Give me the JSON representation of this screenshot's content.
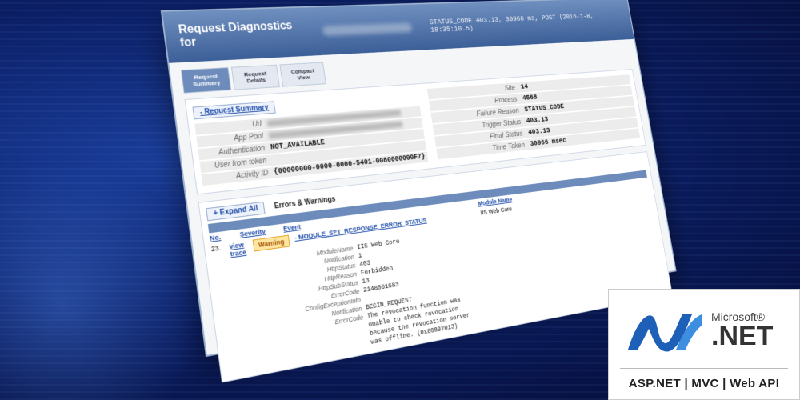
{
  "window": {
    "title": "Request Diagnostics for",
    "status": "STATUS_CODE 403.13, 30966 ms, POST (2016-1-8, 18:35:10.5)"
  },
  "tabs": [
    {
      "label": "Request Summary"
    },
    {
      "label": "Request Details"
    },
    {
      "label": "Compact View"
    }
  ],
  "summary": {
    "section_label": "- Request Summary",
    "left": [
      {
        "key": "Url",
        "value": ""
      },
      {
        "key": "App Pool",
        "value": ""
      },
      {
        "key": "Authentication",
        "value": "NOT_AVAILABLE"
      },
      {
        "key": "User from token",
        "value": ""
      },
      {
        "key": "Activity ID",
        "value": "{00000000-0000-0000-5401-0080000000F7}"
      }
    ],
    "right": [
      {
        "key": "Site",
        "value": "14"
      },
      {
        "key": "Process",
        "value": "4568"
      },
      {
        "key": "Failure Reason",
        "value": "STATUS_CODE"
      },
      {
        "key": "Trigger Status",
        "value": "403.13"
      },
      {
        "key": "Final Status",
        "value": "403.13"
      },
      {
        "key": "Time Taken",
        "value": "30966 msec"
      }
    ]
  },
  "errors": {
    "expand_label": "+ Expand All",
    "title": "Errors & Warnings",
    "columns": {
      "no": "No.",
      "severity": "Severity",
      "event": "Event",
      "module": "Module Name"
    },
    "row": {
      "no": "23.",
      "view_trace": "view trace",
      "severity": "Warning",
      "event": "- MODULE_SET_RESPONSE_ERROR_STATUS",
      "module": "IIS Web Core"
    },
    "details": [
      {
        "key": "ModuleName",
        "value": "IIS Web Core"
      },
      {
        "key": "Notification",
        "value": "1"
      },
      {
        "key": "HttpStatus",
        "value": "403"
      },
      {
        "key": "HttpReason",
        "value": "Forbidden"
      },
      {
        "key": "HttpSubStatus",
        "value": "13"
      },
      {
        "key": "ErrorCode",
        "value": "2148081683"
      },
      {
        "key": "ConfigExceptionInfo",
        "value": ""
      },
      {
        "key": "Notification",
        "value": "BEGIN_REQUEST"
      },
      {
        "key": "ErrorCode",
        "value": "The revocation function was unable to check revocation because the revocation server was offline. (0x80092013)"
      }
    ]
  },
  "badge": {
    "microsoft": "Microsoft®",
    "net": ".NET",
    "tagline": "ASP.NET | MVC | Web API",
    "colors": {
      "logo_blue": "#1e5fb8",
      "logo_light": "#3d8ee0"
    }
  }
}
